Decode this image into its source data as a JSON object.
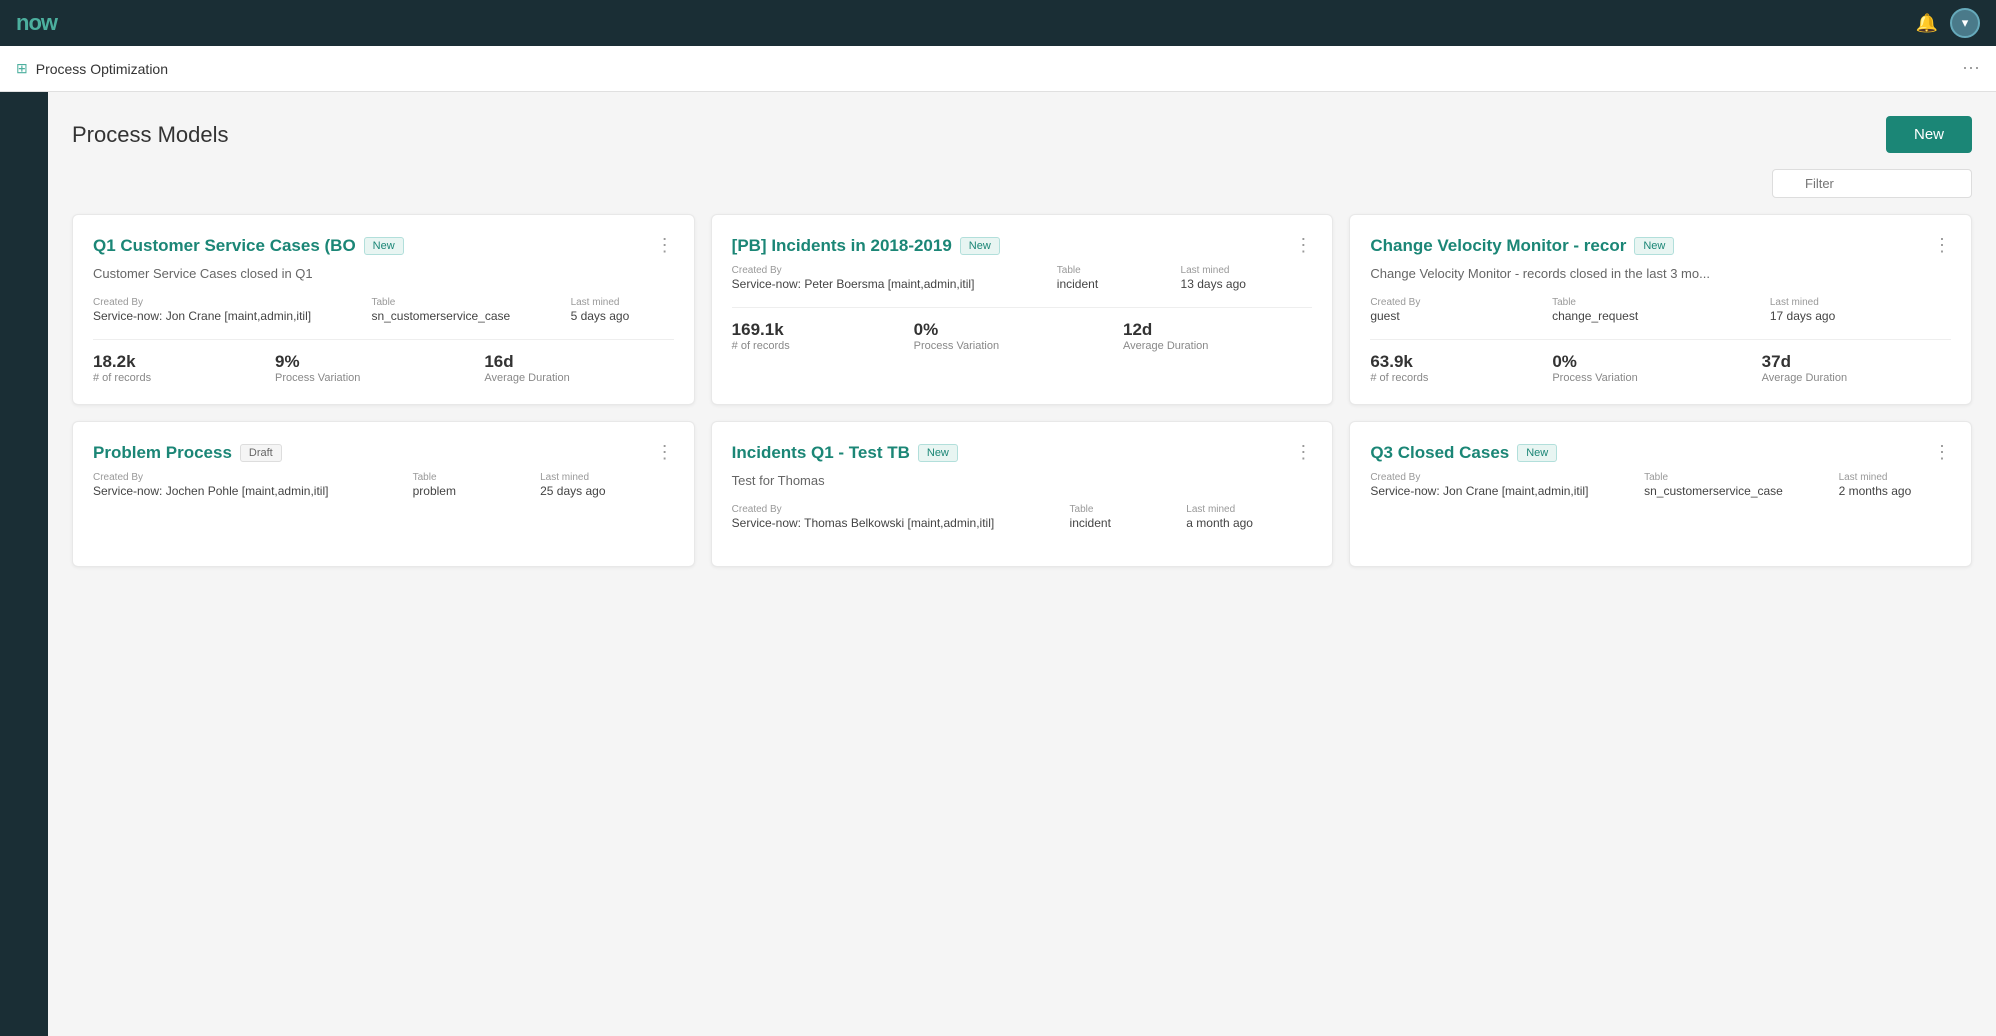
{
  "topnav": {
    "logo": "now",
    "bell_icon": "🔔",
    "user_icon": "👤"
  },
  "secondnav": {
    "icon": "⊞",
    "title": "Process Optimization",
    "more_icon": "⋯"
  },
  "page": {
    "title": "Process Models",
    "new_button": "New",
    "filter_placeholder": "Filter"
  },
  "cards": [
    {
      "id": "card-1",
      "title": "Q1 Customer Service Cases (BO",
      "badge": "New",
      "badge_type": "new",
      "description": "Customer Service Cases closed in Q1",
      "created_by_label": "Created By",
      "created_by": "Service-now: Jon Crane [maint,admin,itil]",
      "table_label": "Table",
      "table": "sn_customerservice_case",
      "last_mined_label": "Last mined",
      "last_mined": "5 days ago",
      "stat1_value": "18.2k",
      "stat1_label": "# of records",
      "stat2_value": "9%",
      "stat2_label": "Process Variation",
      "stat3_value": "16d",
      "stat3_label": "Average Duration"
    },
    {
      "id": "card-2",
      "title": "[PB] Incidents in 2018-2019",
      "badge": "New",
      "badge_type": "new",
      "description": "",
      "created_by_label": "Created By",
      "created_by": "Service-now: Peter Boersma [maint,admin,itil]",
      "table_label": "Table",
      "table": "incident",
      "last_mined_label": "Last mined",
      "last_mined": "13 days ago",
      "stat1_value": "169.1k",
      "stat1_label": "# of records",
      "stat2_value": "0%",
      "stat2_label": "Process Variation",
      "stat3_value": "12d",
      "stat3_label": "Average Duration"
    },
    {
      "id": "card-3",
      "title": "Change Velocity Monitor - recor",
      "badge": "New",
      "badge_type": "new",
      "description": "Change Velocity Monitor - records closed in the last 3 mo...",
      "created_by_label": "Created By",
      "created_by": "guest",
      "table_label": "Table",
      "table": "change_request",
      "last_mined_label": "Last mined",
      "last_mined": "17 days ago",
      "stat1_value": "63.9k",
      "stat1_label": "# of records",
      "stat2_value": "0%",
      "stat2_label": "Process Variation",
      "stat3_value": "37d",
      "stat3_label": "Average Duration"
    },
    {
      "id": "card-4",
      "title": "Problem Process",
      "badge": "Draft",
      "badge_type": "draft",
      "description": "",
      "created_by_label": "Created By",
      "created_by": "Service-now: Jochen Pohle [maint,admin,itil]",
      "table_label": "Table",
      "table": "problem",
      "last_mined_label": "Last mined",
      "last_mined": "25 days ago",
      "stat1_value": "",
      "stat1_label": "",
      "stat2_value": "",
      "stat2_label": "",
      "stat3_value": "",
      "stat3_label": ""
    },
    {
      "id": "card-5",
      "title": "Incidents Q1 - Test TB",
      "badge": "New",
      "badge_type": "new",
      "description": "Test for Thomas",
      "created_by_label": "Created By",
      "created_by": "Service-now: Thomas Belkowski [maint,admin,itil]",
      "table_label": "Table",
      "table": "incident",
      "last_mined_label": "Last mined",
      "last_mined": "a month ago",
      "stat1_value": "",
      "stat1_label": "",
      "stat2_value": "",
      "stat2_label": "",
      "stat3_value": "",
      "stat3_label": ""
    },
    {
      "id": "card-6",
      "title": "Q3 Closed Cases",
      "badge": "New",
      "badge_type": "new",
      "description": "",
      "created_by_label": "Created By",
      "created_by": "Service-now: Jon Crane [maint,admin,itil]",
      "table_label": "Table",
      "table": "sn_customerservice_case",
      "last_mined_label": "Last mined",
      "last_mined": "2 months ago",
      "stat1_value": "",
      "stat1_label": "",
      "stat2_value": "",
      "stat2_label": "",
      "stat3_value": "",
      "stat3_label": ""
    }
  ]
}
